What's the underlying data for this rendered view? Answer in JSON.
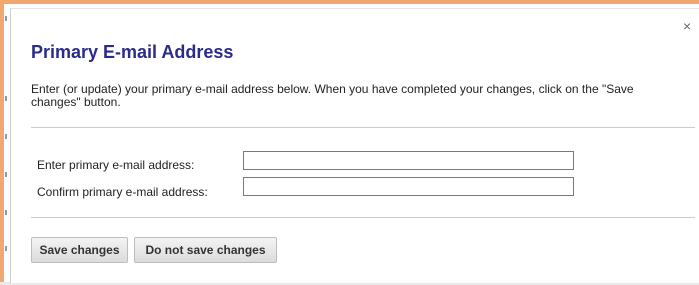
{
  "dialog": {
    "close_glyph": "×",
    "title": "Primary E-mail Address",
    "description": "Enter (or update) your primary e-mail address below. When you have completed your changes, click on the \"Save changes\" button."
  },
  "form": {
    "primary_label": "Enter primary e-mail address:",
    "primary_value": "",
    "confirm_label": "Confirm primary e-mail address:",
    "confirm_value": ""
  },
  "buttons": {
    "save_label": "Save changes",
    "nosave_label": "Do not save changes"
  },
  "colors": {
    "title": "#2b2b8c",
    "window_edge": "#f0a870"
  },
  "icons": {
    "close": "close-icon"
  }
}
